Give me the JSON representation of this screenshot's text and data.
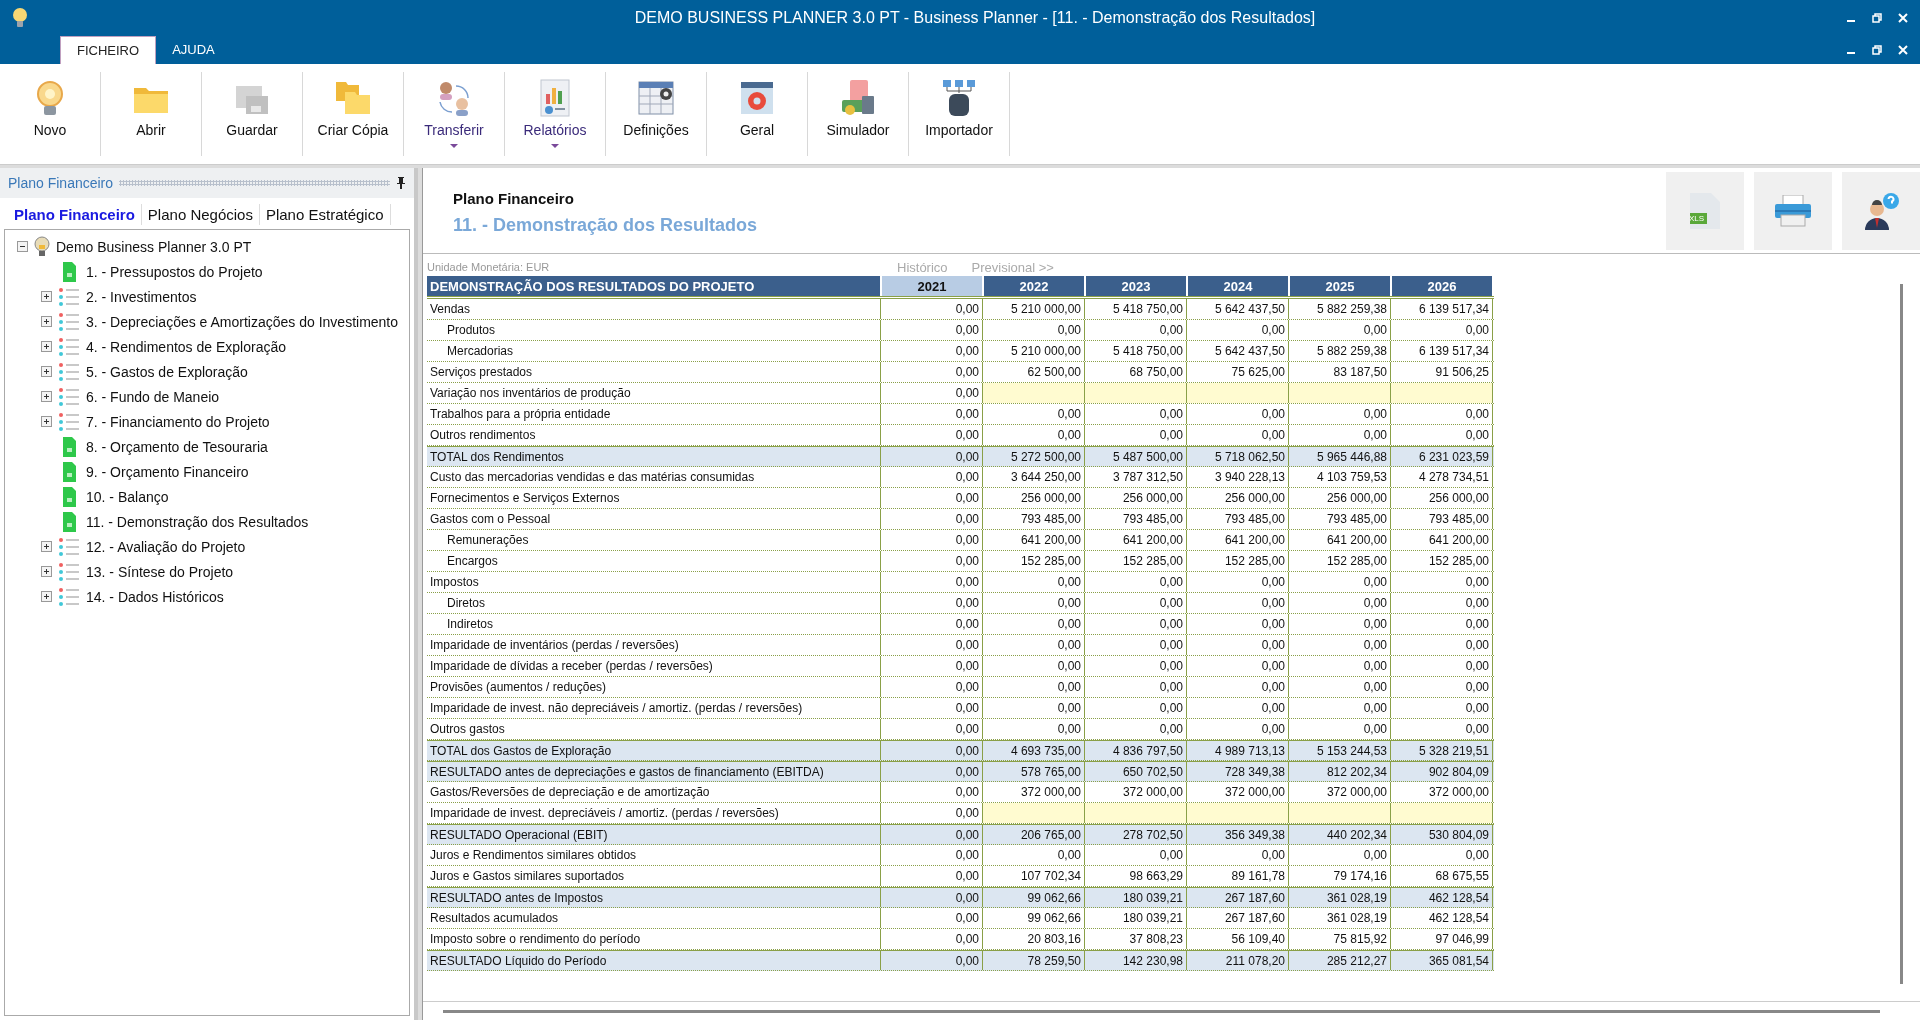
{
  "window": {
    "title": "DEMO BUSINESS PLANNER 3.0 PT - Business Planner - [11. - Demonstração dos Resultados]"
  },
  "ribbon_tabs": [
    {
      "label": "FICHEIRO",
      "selected": true
    },
    {
      "label": "AJUDA",
      "selected": false
    }
  ],
  "ribbon_buttons": [
    {
      "label": "Novo",
      "kind": "bulb",
      "dropdown": false,
      "disabled": false
    },
    {
      "label": "Abrir",
      "kind": "folder",
      "dropdown": false,
      "disabled": false
    },
    {
      "label": "Guardar",
      "kind": "save",
      "dropdown": false,
      "disabled": true
    },
    {
      "label": "Criar Cópia",
      "kind": "copy",
      "dropdown": false,
      "disabled": false
    },
    {
      "label": "Transferir",
      "kind": "transfer",
      "dropdown": true,
      "disabled": false
    },
    {
      "label": "Relatórios",
      "kind": "report",
      "dropdown": true,
      "disabled": false
    },
    {
      "label": "Definições",
      "kind": "settings",
      "dropdown": false,
      "disabled": false
    },
    {
      "label": "Geral",
      "kind": "gear",
      "dropdown": false,
      "disabled": false
    },
    {
      "label": "Simulador",
      "kind": "simulator",
      "dropdown": false,
      "disabled": false
    },
    {
      "label": "Importador",
      "kind": "importer",
      "dropdown": false,
      "disabled": false
    }
  ],
  "sidebar": {
    "title": "Plano Financeiro",
    "tabs": [
      {
        "label": "Plano Financeiro",
        "selected": true
      },
      {
        "label": "Plano Negócios",
        "selected": false
      },
      {
        "label": "Plano Estratégico",
        "selected": false
      }
    ],
    "tree": {
      "label": "Demo Business Planner 3.0 PT",
      "expanded": true,
      "children": [
        {
          "label": "1. - Pressupostos do Projeto",
          "kind": "sheet"
        },
        {
          "label": "2. - Investimentos",
          "kind": "group"
        },
        {
          "label": "3. - Depreciações e Amortizações do Investimento",
          "kind": "group"
        },
        {
          "label": "4. - Rendimentos de Exploração",
          "kind": "group"
        },
        {
          "label": "5. - Gastos de Exploração",
          "kind": "group"
        },
        {
          "label": "6. - Fundo de Maneio",
          "kind": "group"
        },
        {
          "label": "7. - Financiamento do Projeto",
          "kind": "group"
        },
        {
          "label": "8. - Orçamento de Tesouraria",
          "kind": "sheet"
        },
        {
          "label": "9. - Orçamento Financeiro",
          "kind": "sheet"
        },
        {
          "label": "10. - Balanço",
          "kind": "sheet"
        },
        {
          "label": "11. - Demonstração dos Resultados",
          "kind": "sheet"
        },
        {
          "label": "12. - Avaliação do Projeto",
          "kind": "group"
        },
        {
          "label": "13. - Síntese do Projeto",
          "kind": "group"
        },
        {
          "label": "14. - Dados Históricos",
          "kind": "group"
        }
      ]
    }
  },
  "content": {
    "section": "Plano Financeiro",
    "title": "11. - Demonstração dos Resultados",
    "xls_label": "XLS",
    "currency": "Unidade Monetária: EUR",
    "historic_label": "Histórico",
    "forecast_label": "Previsional >>",
    "table": {
      "heading": "DEMONSTRAÇÃO DOS RESULTADOS DO PROJETO",
      "columns": [
        {
          "label": "2021",
          "historic": true
        },
        {
          "label": "2022",
          "historic": false
        },
        {
          "label": "2023",
          "historic": false
        },
        {
          "label": "2024",
          "historic": false
        },
        {
          "label": "2025",
          "historic": false
        },
        {
          "label": "2026",
          "historic": false
        }
      ],
      "rows": [
        {
          "label": "Vendas",
          "kind": "normal",
          "values": [
            "0,00",
            "5 210 000,00",
            "5 418 750,00",
            "5 642 437,50",
            "5 882 259,38",
            "6 139 517,34"
          ]
        },
        {
          "label": "Produtos",
          "kind": "sub",
          "values": [
            "0,00",
            "0,00",
            "0,00",
            "0,00",
            "0,00",
            "0,00"
          ]
        },
        {
          "label": "Mercadorias",
          "kind": "sub",
          "values": [
            "0,00",
            "5 210 000,00",
            "5 418 750,00",
            "5 642 437,50",
            "5 882 259,38",
            "6 139 517,34"
          ]
        },
        {
          "label": "Serviços prestados",
          "kind": "normal",
          "values": [
            "0,00",
            "62 500,00",
            "68 750,00",
            "75 625,00",
            "83 187,50",
            "91 506,25"
          ]
        },
        {
          "label": "Variação nos inventários de produção",
          "kind": "input",
          "values": [
            "0,00"
          ]
        },
        {
          "label": "Trabalhos para a própria entidade",
          "kind": "normal",
          "values": [
            "0,00",
            "0,00",
            "0,00",
            "0,00",
            "0,00",
            "0,00"
          ]
        },
        {
          "label": "Outros rendimentos",
          "kind": "normal",
          "values": [
            "0,00",
            "0,00",
            "0,00",
            "0,00",
            "0,00",
            "0,00"
          ]
        },
        {
          "label": "TOTAL dos Rendimentos",
          "kind": "total",
          "values": [
            "0,00",
            "5 272 500,00",
            "5 487 500,00",
            "5 718 062,50",
            "5 965 446,88",
            "6 231 023,59"
          ]
        },
        {
          "label": "Custo das mercadorias vendidas e das matérias consumidas",
          "kind": "normal",
          "values": [
            "0,00",
            "3 644 250,00",
            "3 787 312,50",
            "3 940 228,13",
            "4 103 759,53",
            "4 278 734,51"
          ]
        },
        {
          "label": "Fornecimentos e Serviços Externos",
          "kind": "normal",
          "values": [
            "0,00",
            "256 000,00",
            "256 000,00",
            "256 000,00",
            "256 000,00",
            "256 000,00"
          ]
        },
        {
          "label": "Gastos com o Pessoal",
          "kind": "normal",
          "values": [
            "0,00",
            "793 485,00",
            "793 485,00",
            "793 485,00",
            "793 485,00",
            "793 485,00"
          ]
        },
        {
          "label": "Remunerações",
          "kind": "sub",
          "values": [
            "0,00",
            "641 200,00",
            "641 200,00",
            "641 200,00",
            "641 200,00",
            "641 200,00"
          ]
        },
        {
          "label": "Encargos",
          "kind": "sub",
          "values": [
            "0,00",
            "152 285,00",
            "152 285,00",
            "152 285,00",
            "152 285,00",
            "152 285,00"
          ]
        },
        {
          "label": "Impostos",
          "kind": "normal",
          "values": [
            "0,00",
            "0,00",
            "0,00",
            "0,00",
            "0,00",
            "0,00"
          ]
        },
        {
          "label": "Diretos",
          "kind": "sub",
          "values": [
            "0,00",
            "0,00",
            "0,00",
            "0,00",
            "0,00",
            "0,00"
          ]
        },
        {
          "label": "Indiretos",
          "kind": "sub",
          "values": [
            "0,00",
            "0,00",
            "0,00",
            "0,00",
            "0,00",
            "0,00"
          ]
        },
        {
          "label": "Imparidade de inventários (perdas / reversões)",
          "kind": "normal",
          "values": [
            "0,00",
            "0,00",
            "0,00",
            "0,00",
            "0,00",
            "0,00"
          ]
        },
        {
          "label": "Imparidade de dívidas a receber (perdas / reversões)",
          "kind": "normal",
          "values": [
            "0,00",
            "0,00",
            "0,00",
            "0,00",
            "0,00",
            "0,00"
          ]
        },
        {
          "label": "Provisões (aumentos / reduções)",
          "kind": "normal",
          "values": [
            "0,00",
            "0,00",
            "0,00",
            "0,00",
            "0,00",
            "0,00"
          ]
        },
        {
          "label": "Imparidade de invest. não depreciáveis / amortiz. (perdas / reversões)",
          "kind": "normal",
          "values": [
            "0,00",
            "0,00",
            "0,00",
            "0,00",
            "0,00",
            "0,00"
          ]
        },
        {
          "label": "Outros gastos",
          "kind": "normal",
          "values": [
            "0,00",
            "0,00",
            "0,00",
            "0,00",
            "0,00",
            "0,00"
          ]
        },
        {
          "label": "TOTAL dos Gastos de Exploração",
          "kind": "total",
          "values": [
            "0,00",
            "4 693 735,00",
            "4 836 797,50",
            "4 989 713,13",
            "5 153 244,53",
            "5 328 219,51"
          ]
        },
        {
          "label": "RESULTADO antes de depreciações e gastos de financiamento (EBITDA)",
          "kind": "total",
          "values": [
            "0,00",
            "578 765,00",
            "650 702,50",
            "728 349,38",
            "812 202,34",
            "902 804,09"
          ]
        },
        {
          "label": "Gastos/Reversões de depreciação e de amortização",
          "kind": "normal",
          "values": [
            "0,00",
            "372 000,00",
            "372 000,00",
            "372 000,00",
            "372 000,00",
            "372 000,00"
          ]
        },
        {
          "label": "Imparidade de invest. depreciáveis / amortiz. (perdas / reversões)",
          "kind": "input",
          "values": [
            "0,00"
          ]
        },
        {
          "label": "RESULTADO Operacional (EBIT)",
          "kind": "total",
          "values": [
            "0,00",
            "206 765,00",
            "278 702,50",
            "356 349,38",
            "440 202,34",
            "530 804,09"
          ]
        },
        {
          "label": "Juros e Rendimentos similares obtidos",
          "kind": "normal",
          "values": [
            "0,00",
            "0,00",
            "0,00",
            "0,00",
            "0,00",
            "0,00"
          ]
        },
        {
          "label": "Juros e Gastos similares suportados",
          "kind": "normal",
          "values": [
            "0,00",
            "107 702,34",
            "98 663,29",
            "89 161,78",
            "79 174,16",
            "68 675,55"
          ]
        },
        {
          "label": "RESULTADO antes de Impostos",
          "kind": "total",
          "values": [
            "0,00",
            "99 062,66",
            "180 039,21",
            "267 187,60",
            "361 028,19",
            "462 128,54"
          ]
        },
        {
          "label": "Resultados acumulados",
          "kind": "normal",
          "values": [
            "0,00",
            "99 062,66",
            "180 039,21",
            "267 187,60",
            "361 028,19",
            "462 128,54"
          ]
        },
        {
          "label": "Imposto sobre o rendimento do período",
          "kind": "normal",
          "values": [
            "0,00",
            "20 803,16",
            "37 808,23",
            "56 109,40",
            "75 815,92",
            "97 046,99"
          ]
        },
        {
          "label": "RESULTADO Líquido do Período",
          "kind": "total",
          "values": [
            "0,00",
            "78 259,50",
            "142 230,98",
            "211 078,20",
            "285 212,27",
            "365 081,54"
          ]
        }
      ]
    }
  }
}
